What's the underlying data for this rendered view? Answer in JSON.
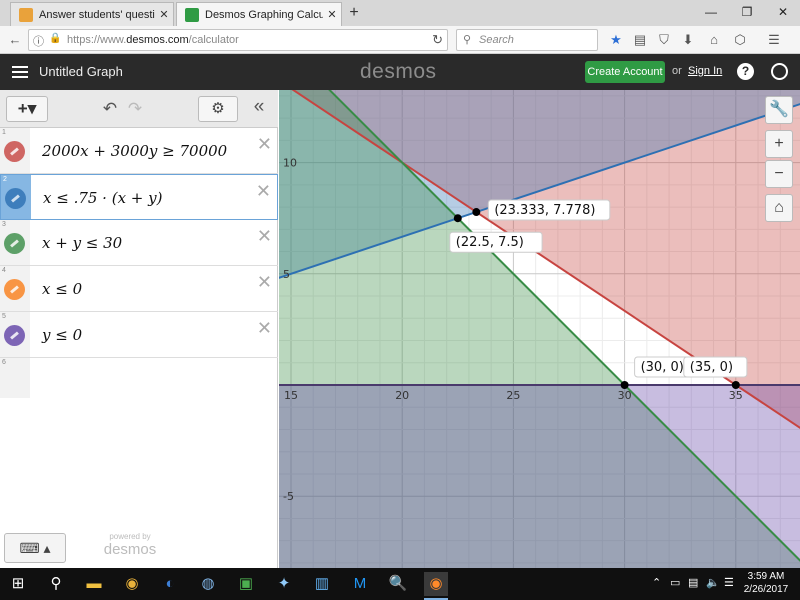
{
  "browser": {
    "tabs": [
      {
        "title": "Answer students' question...",
        "active": false
      },
      {
        "title": "Desmos Graphing Calcula...",
        "active": true
      }
    ],
    "url_prefix": "https://www.",
    "url_domain": "desmos.com",
    "url_path": "/calculator",
    "search_placeholder": "Search"
  },
  "header": {
    "graph_title": "Untitled Graph",
    "logo": "desmos",
    "create_account": "Create Account",
    "or": "or",
    "sign_in": "Sign In",
    "help": "?"
  },
  "expressions": [
    {
      "num": "1",
      "latex": "2000x + 3000y ≥ 70000",
      "color": "#c74440"
    },
    {
      "num": "2",
      "latex": "x ≤ .75 · (x + y)",
      "color": "#2d70b3"
    },
    {
      "num": "3",
      "latex": "x + y ≤ 30",
      "color": "#388c46"
    },
    {
      "num": "4",
      "latex": "x ≤ 0",
      "color": "#fa7e19"
    },
    {
      "num": "5",
      "latex": "y ≤ 0",
      "color": "#6042a6"
    }
  ],
  "empty_row_num": "6",
  "powered_by": "powered by",
  "powered_logo": "desmos",
  "graph": {
    "x_ticks": [
      "15",
      "20",
      "25",
      "30",
      "35"
    ],
    "y_ticks": [
      "10",
      "5",
      "-5"
    ],
    "points": [
      {
        "label": "(23.333, 7.778)",
        "x": 23.333,
        "y": 7.778
      },
      {
        "label": "(22.5, 7.5)",
        "x": 22.5,
        "y": 7.5
      },
      {
        "label": "(30, 0)",
        "x": 30,
        "y": 0
      },
      {
        "label": "(35, 0)",
        "x": 35,
        "y": 0
      }
    ]
  },
  "taskbar": {
    "time": "3:59 AM",
    "date": "2/26/2017"
  }
}
